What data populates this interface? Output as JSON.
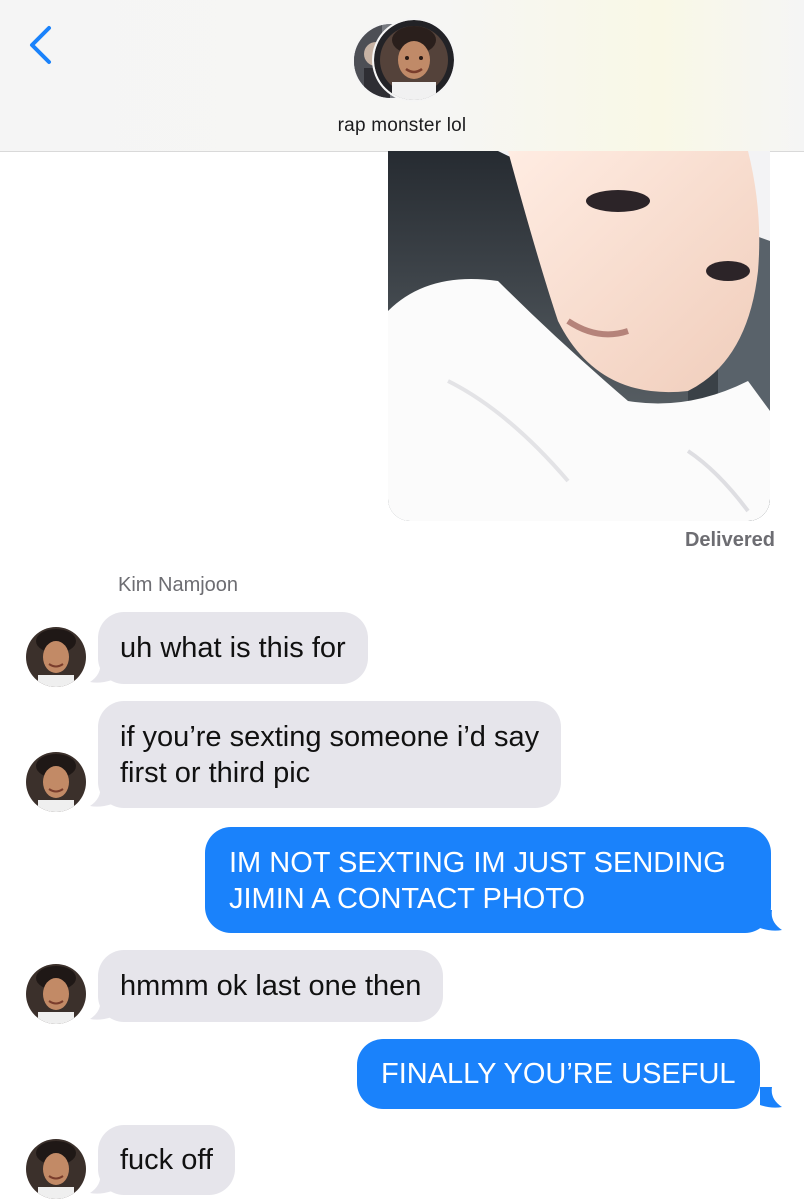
{
  "header": {
    "contact_title": "rap monster lol"
  },
  "status": {
    "delivered": "Delivered"
  },
  "thread": {
    "sender_name": "Kim Namjoon",
    "messages": [
      {
        "from": "them",
        "text": "uh what is this for"
      },
      {
        "from": "them",
        "lines": [
          "if you’re sexting someone i’d say",
          "first or third pic"
        ]
      },
      {
        "from": "me",
        "lines": [
          "IM NOT SEXTING IM JUST SENDING",
          "JIMIN A CONTACT PHOTO"
        ]
      },
      {
        "from": "them",
        "text": "hmmm ok last one then"
      },
      {
        "from": "me",
        "text": "FINALLY YOU’RE USEFUL"
      },
      {
        "from": "them",
        "text": "fuck off"
      }
    ]
  },
  "icons": {
    "back": "chevron-left-icon",
    "contact_avatars": "group-avatar-icon",
    "photo": "image-attachment-icon"
  },
  "colors": {
    "accent_blue": "#1a82fb",
    "incoming_bubble": "#e6e5eb",
    "header_bg": "#f5f5f5"
  }
}
